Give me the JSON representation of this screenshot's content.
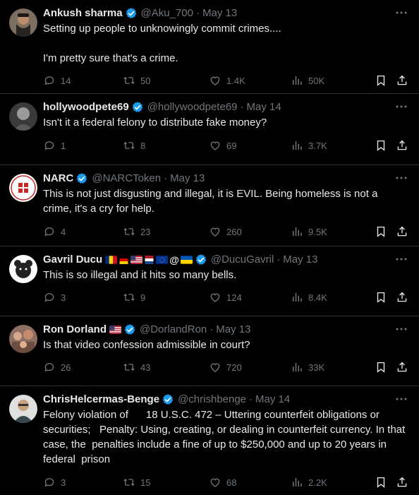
{
  "tweets": [
    {
      "name": "Ankush sharma",
      "handle": "@Aku_700",
      "date": "May 13",
      "text": "Setting up people to unknowingly commit crimes....\n\nI'm pretty sure that's a crime.",
      "replies": "14",
      "retweets": "50",
      "likes": "1.4K",
      "views": "50K",
      "avatar_icon": "avatar-photo-man-beard"
    },
    {
      "name": "hollywoodpete69",
      "handle": "@hollywoodpete69",
      "date": "May 14",
      "text": "Isn't it a federal felony to distribute fake money?",
      "replies": "1",
      "retweets": "8",
      "likes": "69",
      "views": "3.7K",
      "avatar_icon": "avatar-photo-grayscale-man"
    },
    {
      "name": "NARC",
      "handle": "@NARCToken",
      "date": "May 13",
      "text": "This is not just disgusting and illegal, it is EVIL. Being homeless is not a crime, it's a cry for help.",
      "replies": "4",
      "retweets": "23",
      "likes": "260",
      "views": "9.5K",
      "avatar_icon": "avatar-narc-token-logo"
    },
    {
      "name": "Gavril Ducu",
      "name_suffix": "@",
      "handle": "@DucuGavril",
      "date": "May 13",
      "text": "This is so illegal and it hits so many bells.",
      "replies": "3",
      "retweets": "9",
      "likes": "124",
      "views": "8.4K",
      "avatar_icon": "avatar-cartoon-bear"
    },
    {
      "name": "Ron Dorland",
      "handle": "@DorlandRon",
      "date": "May 13",
      "text": "Is that video confession admissible in court?",
      "replies": "26",
      "retweets": "43",
      "likes": "720",
      "views": "33K",
      "avatar_icon": "avatar-photo-crowd"
    },
    {
      "name": "ChrisHelcermas-Benge",
      "handle": "@chrishbenge",
      "date": "May 14",
      "text": "Felony violation of      18 U.S.C. 472 – Uttering counterfeit obligations or securities;   Penalty: Using, creating, or dealing in counterfeit currency. In that case, the  penalties include a fine of up to $250,000 and up to 20 years in federal  prison",
      "replies": "3",
      "retweets": "15",
      "likes": "68",
      "views": "2.2K",
      "avatar_icon": "avatar-photo-man-glasses"
    }
  ],
  "colors": {
    "background": "#000000",
    "text": "#e7e9ea",
    "muted": "#71767b",
    "verified": "#1d9bf0",
    "divider": "#2f3336"
  }
}
